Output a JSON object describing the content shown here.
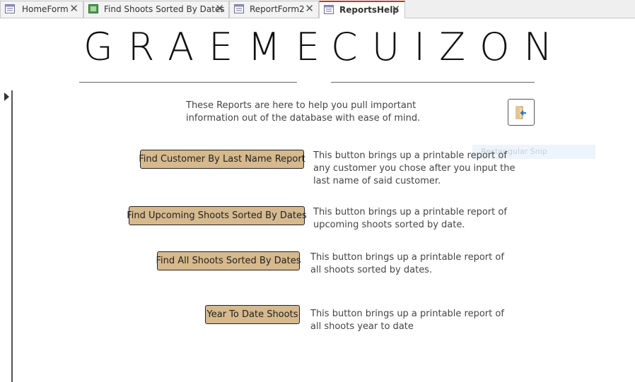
{
  "tabs": [
    {
      "label": "HomeForm",
      "icon": "form-icon",
      "active": false
    },
    {
      "label": "Find Shoots Sorted By Dates",
      "icon": "report-icon",
      "active": false
    },
    {
      "label": "ReportForm2",
      "icon": "form-icon",
      "active": false
    },
    {
      "label": "ReportsHelp",
      "icon": "form-icon",
      "active": true
    }
  ],
  "header": {
    "title_first": "GRAEME",
    "title_last": "CUIZON"
  },
  "intro_text": "These Reports are here to help you pull important information out of the database with ease of mind.",
  "exit_button_icon": "exit-door-icon",
  "snip_overlay": "Rectangular Snip",
  "reports": [
    {
      "button_label": "Find Customer By Last Name Report",
      "description": "This button brings up a printable report of any customer you chose after you input the last name of said customer."
    },
    {
      "button_label": "Find Upcoming Shoots Sorted By Dates",
      "description": "This button brings up a printable report of upcoming shoots sorted by date."
    },
    {
      "button_label": "Find All Shoots Sorted By Dates",
      "description": "This button brings up a printable report of all shoots sorted by dates."
    },
    {
      "button_label": "Year To Date Shoots",
      "description": "This button brings up a printable report of all shoots year to date"
    }
  ],
  "colors": {
    "button_fill": "#d6b98d",
    "active_tab_accent": "#c0392b"
  }
}
